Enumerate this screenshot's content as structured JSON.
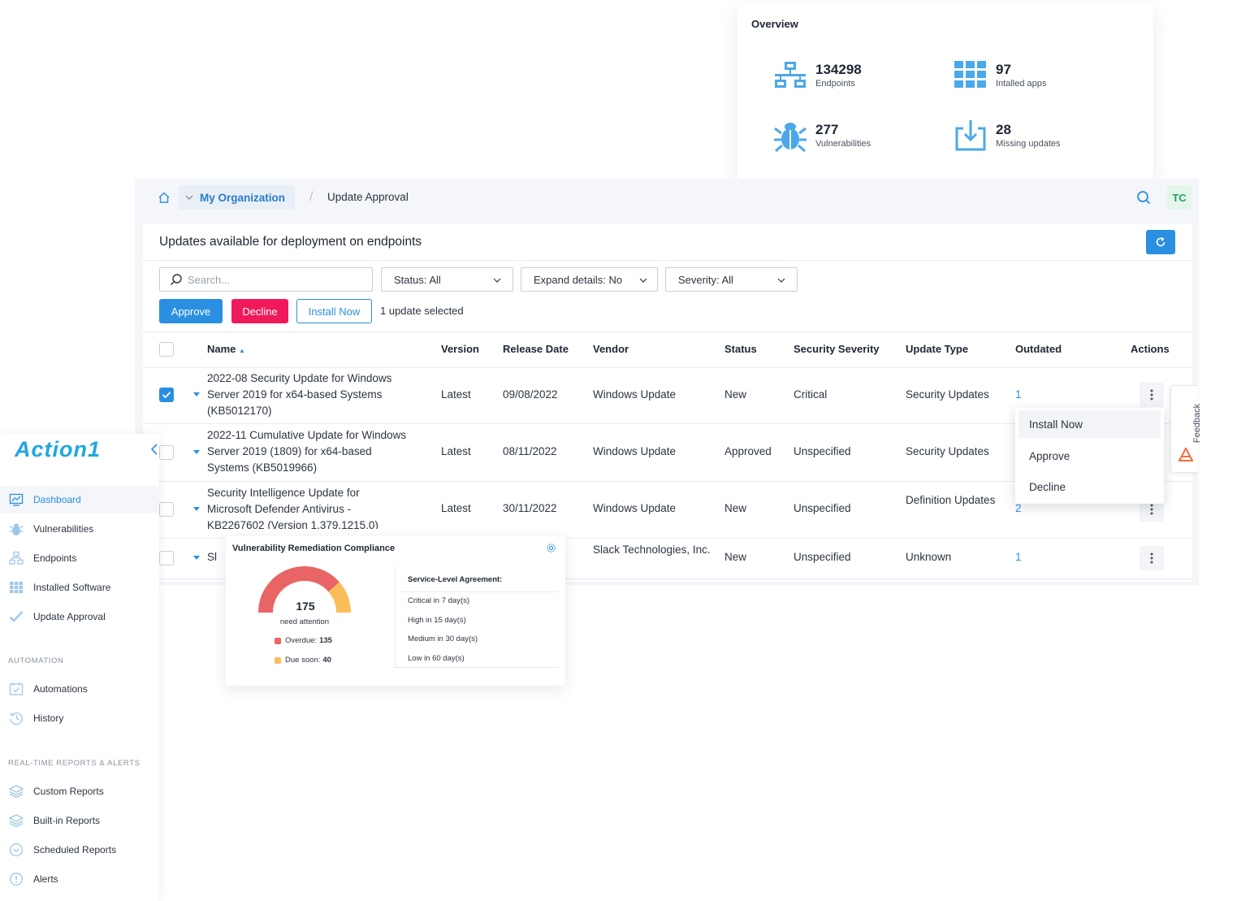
{
  "overview": {
    "title": "Overview",
    "stats": [
      {
        "value": "134298",
        "label": "Endpoints",
        "icon": "network-icon"
      },
      {
        "value": "97",
        "label": "Intalled apps",
        "icon": "apps-grid-icon"
      },
      {
        "value": "277",
        "label": "Vulnerabilities",
        "icon": "bug-icon"
      },
      {
        "value": "28",
        "label": "Missing updates",
        "icon": "download-tray-icon"
      }
    ]
  },
  "topbar": {
    "org": "My Organization",
    "separator": "/",
    "page": "Update Approval",
    "avatar_initials": "TC"
  },
  "panel": {
    "title": "Updates available for deployment on endpoints",
    "search_placeholder": "Search...",
    "filters": {
      "status": "Status: All",
      "expand": "Expand details: No",
      "severity": "Severity: All"
    },
    "buttons": {
      "approve": "Approve",
      "decline": "Decline",
      "install_now": "Install Now"
    },
    "selection_text": "1 update selected"
  },
  "table": {
    "columns": {
      "name": "Name",
      "version": "Version",
      "release_date": "Release Date",
      "vendor": "Vendor",
      "status": "Status",
      "severity": "Security Severity",
      "update_type": "Update Type",
      "outdated": "Outdated",
      "actions": "Actions"
    },
    "sort_indicator": "▲",
    "rows": [
      {
        "name": [
          "2022-08 Security Update for Windows",
          "Server 2019 for x64-based Systems",
          "(KB5012170)"
        ],
        "version": "Latest",
        "release_date": "09/08/2022",
        "vendor": "Windows Update",
        "status": "New",
        "severity": "Critical",
        "update_type": "Security Updates",
        "outdated": "1",
        "checked": true
      },
      {
        "name": [
          "2022-11 Cumulative Update for Windows",
          "Server 2019 (1809) for x64-based",
          "Systems (KB5019966)"
        ],
        "version": "Latest",
        "release_date": "08/11/2022",
        "vendor": "Windows Update",
        "status": "Approved",
        "severity": "Unspecified",
        "update_type": "Security Updates",
        "outdated": "",
        "checked": false
      },
      {
        "name": [
          "Security Intelligence Update for",
          "Microsoft Defender Antivirus -",
          "KB2267602 (Version 1.379.1215.0)"
        ],
        "version": "Latest",
        "release_date": "30/11/2022",
        "vendor": "Windows Update",
        "status": "New",
        "severity": "Unspecified",
        "update_type": "Definition Updates",
        "outdated": "2",
        "checked": false
      },
      {
        "name": [
          "Sl"
        ],
        "version": "",
        "release_date": "",
        "vendor": "Slack Technologies, Inc.",
        "status": "New",
        "severity": "Unspecified",
        "update_type": "Unknown",
        "outdated": "1",
        "checked": false
      }
    ]
  },
  "actions_menu": {
    "items": [
      "Install Now",
      "Approve",
      "Decline"
    ]
  },
  "feedback": {
    "label": "Feedback"
  },
  "sidebar": {
    "logo": "Action1",
    "items": [
      {
        "label": "Dashboard",
        "icon": "chart-icon",
        "active": true
      },
      {
        "label": "Vulnerabilities",
        "icon": "bug-icon"
      },
      {
        "label": "Endpoints",
        "icon": "network-icon"
      },
      {
        "label": "Installed Software",
        "icon": "apps-grid-icon"
      },
      {
        "label": "Update Approval",
        "icon": "check-icon"
      }
    ],
    "automation_section": "AUTOMATION",
    "automation_items": [
      {
        "label": "Automations",
        "icon": "calendar-check-icon"
      },
      {
        "label": "History",
        "icon": "history-icon"
      }
    ],
    "reports_section": "REAL-TIME REPORTS & ALERTS",
    "reports_items": [
      {
        "label": "Custom Reports",
        "icon": "layers-icon"
      },
      {
        "label": "Built-in Reports",
        "icon": "layers-icon"
      },
      {
        "label": "Scheduled Reports",
        "icon": "clock-icon"
      },
      {
        "label": "Alerts",
        "icon": "alert-icon"
      }
    ]
  },
  "compliance": {
    "title": "Vulnerability Remediation Compliance",
    "gauge_value": "175",
    "gauge_label": "need attention",
    "overdue_label": "Overdue:",
    "overdue_value": "135",
    "due_soon_label": "Due soon:",
    "due_soon_value": "40",
    "overdue_fraction": 0.7714,
    "colors": {
      "overdue": "#e96464",
      "due_soon": "#fbbd5a"
    },
    "sla_title": "Service-Level Agreement:",
    "sla_items": [
      "Critical in 7 day(s)",
      "High in 15 day(s)",
      "Medium in 30 day(s)",
      "Low in 60 day(s)"
    ]
  },
  "colors": {
    "accent": "#2a8fe0",
    "decline": "#f0195c",
    "avatar": "#22a35c"
  }
}
